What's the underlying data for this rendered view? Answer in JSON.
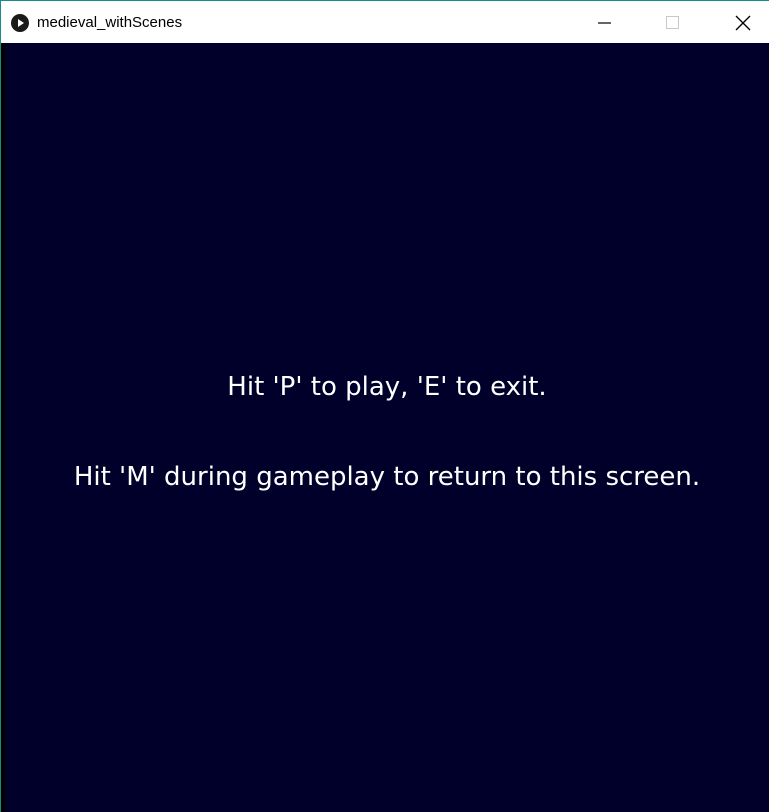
{
  "window": {
    "title": "medieval_withScenes",
    "controls": {
      "minimize_icon": "minimize-icon",
      "maximize_icon": "maximize-icon",
      "close_icon": "close-icon"
    }
  },
  "scene": {
    "background_color": "#00002a",
    "text_color": "#ffffff",
    "lines": [
      "Hit 'P' to play, 'E' to exit.",
      "Hit 'M' during gameplay to return to this screen."
    ]
  }
}
